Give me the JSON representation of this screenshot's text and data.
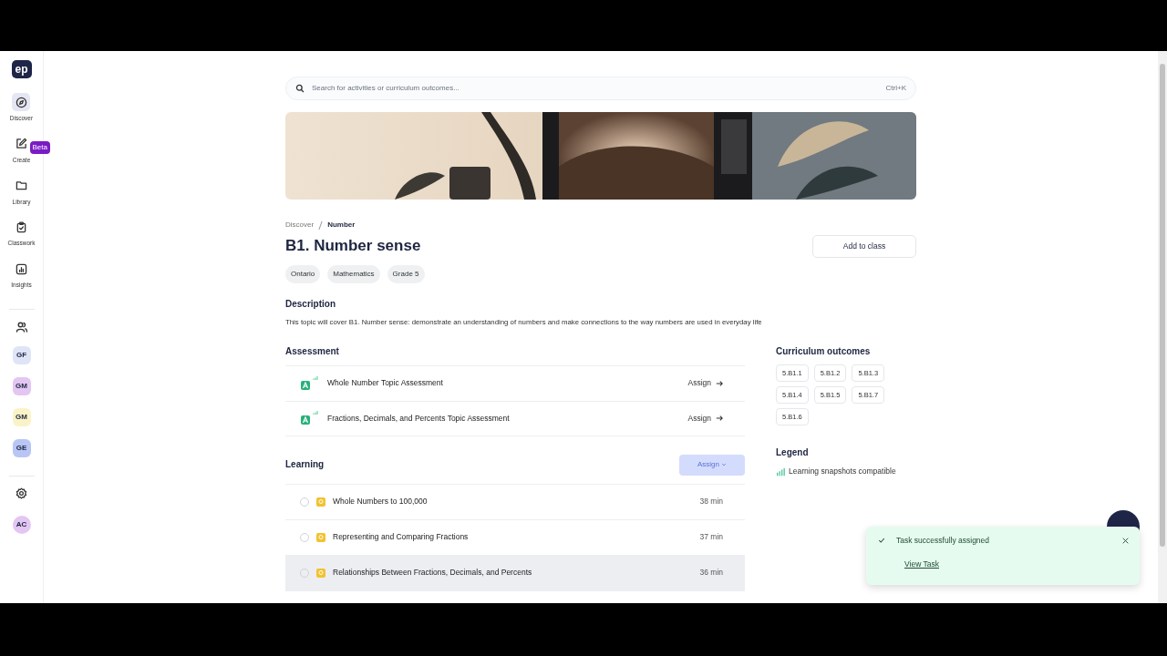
{
  "sidebar": {
    "logo": "ep",
    "nav": [
      {
        "label": "Discover",
        "selected": true
      },
      {
        "label": "Create",
        "selected": false,
        "badge": "Beta"
      },
      {
        "label": "Library",
        "selected": false
      },
      {
        "label": "Classwork",
        "selected": false
      },
      {
        "label": "Insights",
        "selected": false
      }
    ],
    "classes": [
      {
        "initials": "GF",
        "color": "#dfe5f7"
      },
      {
        "initials": "GM",
        "color": "#e3c6f2"
      },
      {
        "initials": "GM",
        "color": "#fbf3c8"
      },
      {
        "initials": "GE",
        "color": "#b9c6f5"
      }
    ],
    "user": {
      "initials": "AC",
      "color": "#e3c6f2"
    }
  },
  "search": {
    "placeholder": "Search for activities or curriculum outcomes...",
    "shortcut": "Ctrl+K"
  },
  "banner": {
    "kind": "picture"
  },
  "breadcrumb": [
    {
      "label": "Discover",
      "current": false
    },
    {
      "label": "Number",
      "current": true
    }
  ],
  "title": "B1. Number sense",
  "add_button": "Add to class",
  "tags": [
    "Ontario",
    "Mathematics",
    "Grade 5"
  ],
  "description": {
    "heading": "Description",
    "text": "This topic will cover B1. Number sense: demonstrate an understanding of numbers and make connections to the way numbers are used in everyday life"
  },
  "assessment": {
    "heading": "Assessment",
    "items": [
      {
        "title": "Whole Number Topic Assessment",
        "action": "Assign"
      },
      {
        "title": "Fractions, Decimals, and Percents Topic Assessment",
        "action": "Assign"
      }
    ]
  },
  "learning": {
    "heading": "Learning",
    "assign_button": {
      "label": "Assign",
      "disabled": true
    },
    "items": [
      {
        "title": "Whole Numbers to 100,000",
        "duration": "38 min",
        "checked": false,
        "hovered": false
      },
      {
        "title": "Representing and Comparing Fractions",
        "duration": "37 min",
        "checked": false,
        "hovered": false
      },
      {
        "title": "Relationships Between Fractions, Decimals, and Percents",
        "duration": "36 min",
        "checked": false,
        "hovered": true
      }
    ]
  },
  "outcomes": {
    "heading": "Curriculum outcomes",
    "codes": [
      "5.B1.1",
      "5.B1.2",
      "5.B1.3",
      "5.B1.4",
      "5.B1.5",
      "5.B1.7",
      "5.B1.6"
    ]
  },
  "legend": {
    "heading": "Legend",
    "items": [
      {
        "label": "Learning snapshots compatible"
      }
    ]
  },
  "toast": {
    "message": "Task successfully assigned",
    "link": "View Task"
  }
}
